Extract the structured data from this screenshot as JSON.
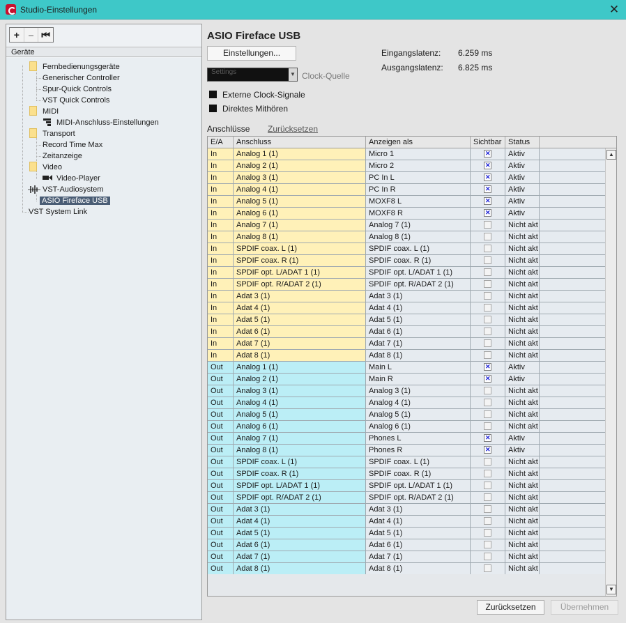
{
  "window": {
    "title": "Studio-Einstellungen",
    "close_glyph": "✕"
  },
  "toolbar": {
    "add": "+",
    "remove": "–",
    "reset": "⏮"
  },
  "tree": {
    "header": "Geräte",
    "items": [
      {
        "label": "Fernbedienungsgeräte",
        "icon": "folder-icon"
      },
      {
        "label": "Generischer Controller"
      },
      {
        "label": "Spur-Quick Controls"
      },
      {
        "label": "VST Quick Controls"
      },
      {
        "label": "MIDI",
        "icon": "folder-icon"
      },
      {
        "label": "MIDI-Anschluss-Einstellungen",
        "icon": "midi-port-icon"
      },
      {
        "label": "Transport",
        "icon": "folder-icon"
      },
      {
        "label": "Record Time Max"
      },
      {
        "label": "Zeitanzeige"
      },
      {
        "label": "Video",
        "icon": "folder-icon"
      },
      {
        "label": "Video-Player",
        "icon": "video-player-icon"
      },
      {
        "label": "VST-Audiosystem",
        "icon": "audio-wave-icon"
      },
      {
        "label": "ASIO Fireface USB",
        "selected": true
      },
      {
        "label": "VST System Link"
      }
    ]
  },
  "device": {
    "title": "ASIO Fireface USB",
    "settings_button": "Einstellungen...",
    "input_latency_label": "Eingangslatenz:",
    "input_latency_value": "6.259 ms",
    "output_latency_label": "Ausgangslatenz:",
    "output_latency_value": "6.825 ms",
    "clock_select_value": "Settings",
    "clock_label": "Clock-Quelle",
    "external_clock_label": "Externe Clock-Signale",
    "direct_monitoring_label": "Direktes Mithören"
  },
  "ports": {
    "label": "Anschlüsse",
    "reset_link": "Zurücksetzen",
    "columns": [
      "E/A",
      "Anschluss",
      "Anzeigen als",
      "Sichtbar",
      "Status"
    ],
    "rows": [
      {
        "io": "In",
        "port": "Analog 1 (1)",
        "show_as": "Micro 1",
        "visible": true,
        "status": "Aktiv"
      },
      {
        "io": "In",
        "port": "Analog 2 (1)",
        "show_as": "Micro 2",
        "visible": true,
        "status": "Aktiv"
      },
      {
        "io": "In",
        "port": "Analog 3 (1)",
        "show_as": "PC In L",
        "visible": true,
        "status": "Aktiv"
      },
      {
        "io": "In",
        "port": "Analog 4 (1)",
        "show_as": "PC In R",
        "visible": true,
        "status": "Aktiv"
      },
      {
        "io": "In",
        "port": "Analog 5 (1)",
        "show_as": "MOXF8 L",
        "visible": true,
        "status": "Aktiv"
      },
      {
        "io": "In",
        "port": "Analog 6 (1)",
        "show_as": "MOXF8 R",
        "visible": true,
        "status": "Aktiv"
      },
      {
        "io": "In",
        "port": "Analog 7 (1)",
        "show_as": "Analog 7 (1)",
        "visible": false,
        "status": "Nicht akt"
      },
      {
        "io": "In",
        "port": "Analog 8 (1)",
        "show_as": "Analog 8 (1)",
        "visible": false,
        "status": "Nicht akt"
      },
      {
        "io": "In",
        "port": "SPDIF coax. L (1)",
        "show_as": "SPDIF coax. L (1)",
        "visible": false,
        "status": "Nicht akt"
      },
      {
        "io": "In",
        "port": "SPDIF coax. R (1)",
        "show_as": "SPDIF coax. R (1)",
        "visible": false,
        "status": "Nicht akt"
      },
      {
        "io": "In",
        "port": "SPDIF opt. L/ADAT 1 (1)",
        "show_as": "SPDIF opt. L/ADAT 1 (1)",
        "visible": false,
        "status": "Nicht akt"
      },
      {
        "io": "In",
        "port": "SPDIF opt. R/ADAT 2 (1)",
        "show_as": "SPDIF opt. R/ADAT 2 (1)",
        "visible": false,
        "status": "Nicht akt"
      },
      {
        "io": "In",
        "port": "Adat 3 (1)",
        "show_as": "Adat 3 (1)",
        "visible": false,
        "status": "Nicht akt"
      },
      {
        "io": "In",
        "port": "Adat 4 (1)",
        "show_as": "Adat 4 (1)",
        "visible": false,
        "status": "Nicht akt"
      },
      {
        "io": "In",
        "port": "Adat 5 (1)",
        "show_as": "Adat 5 (1)",
        "visible": false,
        "status": "Nicht akt"
      },
      {
        "io": "In",
        "port": "Adat 6 (1)",
        "show_as": "Adat 6 (1)",
        "visible": false,
        "status": "Nicht akt"
      },
      {
        "io": "In",
        "port": "Adat 7 (1)",
        "show_as": "Adat 7 (1)",
        "visible": false,
        "status": "Nicht akt"
      },
      {
        "io": "In",
        "port": "Adat 8 (1)",
        "show_as": "Adat 8 (1)",
        "visible": false,
        "status": "Nicht akt"
      },
      {
        "io": "Out",
        "port": "Analog 1 (1)",
        "show_as": "Main L",
        "visible": true,
        "status": "Aktiv"
      },
      {
        "io": "Out",
        "port": "Analog 2 (1)",
        "show_as": "Main R",
        "visible": true,
        "status": "Aktiv"
      },
      {
        "io": "Out",
        "port": "Analog 3 (1)",
        "show_as": "Analog 3 (1)",
        "visible": false,
        "status": "Nicht akt"
      },
      {
        "io": "Out",
        "port": "Analog 4 (1)",
        "show_as": "Analog 4 (1)",
        "visible": false,
        "status": "Nicht akt"
      },
      {
        "io": "Out",
        "port": "Analog 5 (1)",
        "show_as": "Analog 5 (1)",
        "visible": false,
        "status": "Nicht akt"
      },
      {
        "io": "Out",
        "port": "Analog 6 (1)",
        "show_as": "Analog 6 (1)",
        "visible": false,
        "status": "Nicht akt"
      },
      {
        "io": "Out",
        "port": "Analog 7 (1)",
        "show_as": "Phones L",
        "visible": true,
        "status": "Aktiv"
      },
      {
        "io": "Out",
        "port": "Analog 8 (1)",
        "show_as": "Phones R",
        "visible": true,
        "status": "Aktiv"
      },
      {
        "io": "Out",
        "port": "SPDIF coax. L (1)",
        "show_as": "SPDIF coax. L (1)",
        "visible": false,
        "status": "Nicht akt"
      },
      {
        "io": "Out",
        "port": "SPDIF coax. R (1)",
        "show_as": "SPDIF coax. R (1)",
        "visible": false,
        "status": "Nicht akt"
      },
      {
        "io": "Out",
        "port": "SPDIF opt. L/ADAT 1 (1)",
        "show_as": "SPDIF opt. L/ADAT 1 (1)",
        "visible": false,
        "status": "Nicht akt"
      },
      {
        "io": "Out",
        "port": "SPDIF opt. R/ADAT 2 (1)",
        "show_as": "SPDIF opt. R/ADAT 2 (1)",
        "visible": false,
        "status": "Nicht akt"
      },
      {
        "io": "Out",
        "port": "Adat 3 (1)",
        "show_as": "Adat 3 (1)",
        "visible": false,
        "status": "Nicht akt"
      },
      {
        "io": "Out",
        "port": "Adat 4 (1)",
        "show_as": "Adat 4 (1)",
        "visible": false,
        "status": "Nicht akt"
      },
      {
        "io": "Out",
        "port": "Adat 5 (1)",
        "show_as": "Adat 5 (1)",
        "visible": false,
        "status": "Nicht akt"
      },
      {
        "io": "Out",
        "port": "Adat 6 (1)",
        "show_as": "Adat 6 (1)",
        "visible": false,
        "status": "Nicht akt"
      },
      {
        "io": "Out",
        "port": "Adat 7 (1)",
        "show_as": "Adat 7 (1)",
        "visible": false,
        "status": "Nicht akt"
      },
      {
        "io": "Out",
        "port": "Adat 8 (1)",
        "show_as": "Adat 8 (1)",
        "visible": false,
        "status": "Nicht akt"
      }
    ]
  },
  "footer": {
    "reset_button": "Zurücksetzen",
    "apply_button": "Übernehmen"
  },
  "colors": {
    "title_bar": "#3ec8c8",
    "input_row": "#fff1b8",
    "output_row": "#bbeef6",
    "selected_item": "#4a5d75",
    "check_mark": "#1c22d6"
  }
}
